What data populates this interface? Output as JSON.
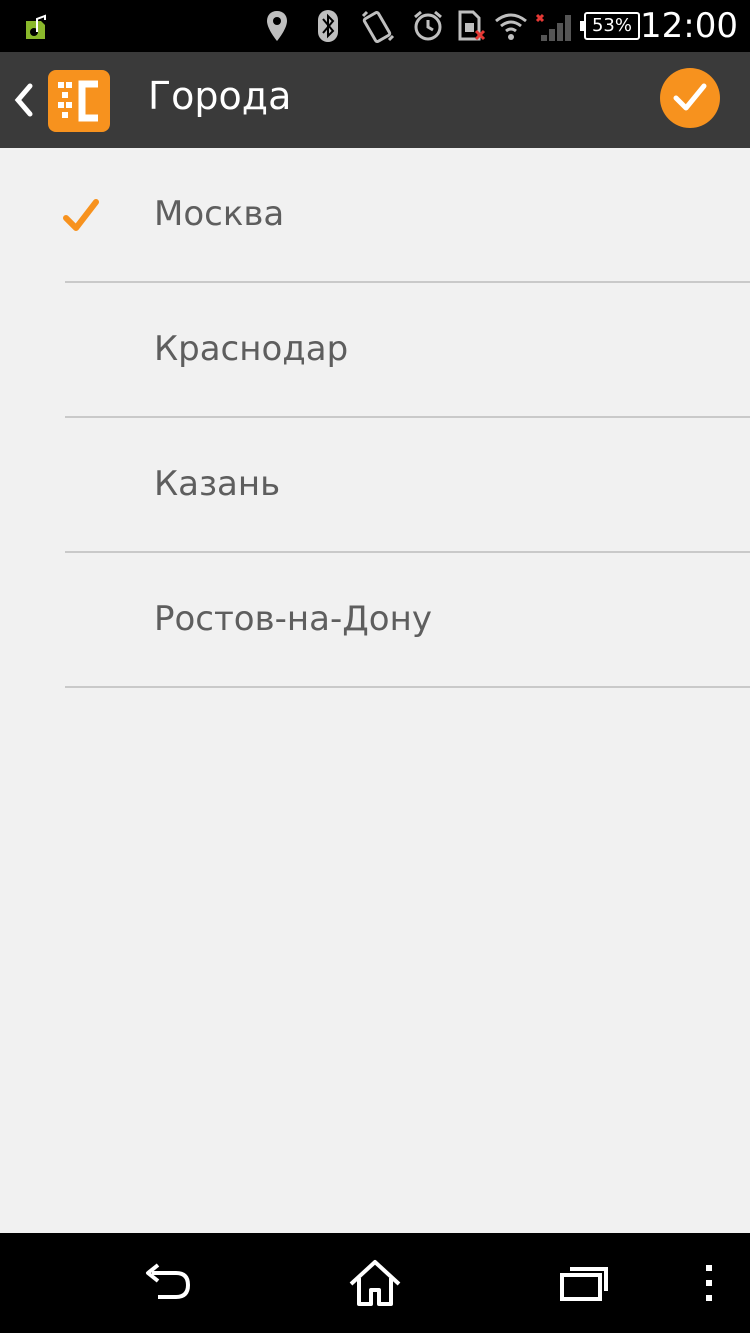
{
  "status_bar": {
    "time": "12:00",
    "battery_percent": "53%",
    "icons": [
      "media-icon",
      "location-icon",
      "bluetooth-icon",
      "vibrate-icon",
      "alarm-icon",
      "sim-error-icon",
      "wifi-icon",
      "signal-icon",
      "battery-icon"
    ]
  },
  "app_bar": {
    "title": "Города",
    "logo": "app-logo-icon",
    "back_icon": "back-chevron-icon",
    "confirm_icon": "checkmark-icon"
  },
  "cities": {
    "selected_index": 0,
    "items": [
      {
        "label": "Москва",
        "selected": true
      },
      {
        "label": "Краснодар",
        "selected": false
      },
      {
        "label": "Казань",
        "selected": false
      },
      {
        "label": "Ростов-на-Дону",
        "selected": false
      }
    ]
  },
  "colors": {
    "accent": "#f7921e",
    "app_bar": "#3a3a3a",
    "background": "#f1f1f1",
    "text": "#5e5e5e"
  },
  "nav_bar": {
    "icons": [
      "back-icon",
      "home-icon",
      "recents-icon",
      "menu-icon"
    ]
  }
}
